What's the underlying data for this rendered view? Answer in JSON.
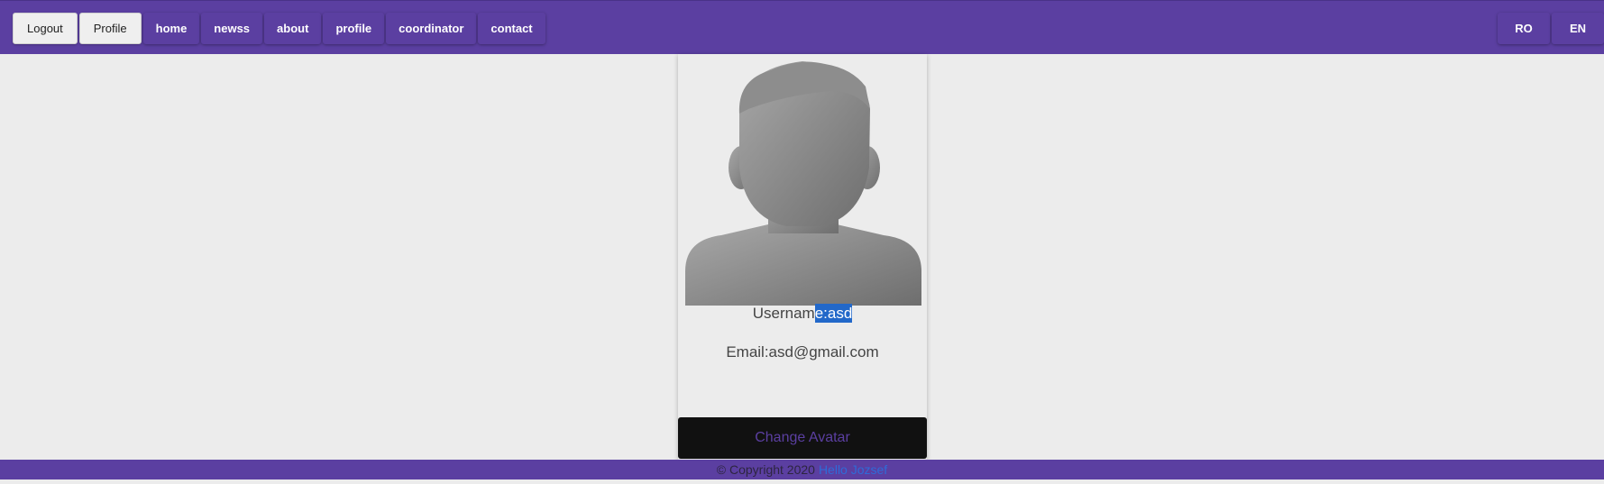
{
  "nav": {
    "logout_label": "Logout",
    "profile_label": "Profile",
    "links": [
      "home",
      "newss",
      "about",
      "profile",
      "coordinator",
      "contact"
    ],
    "lang": [
      "RO",
      "EN"
    ]
  },
  "card": {
    "username_prefix": "Usernam",
    "username_selected": "e:asd",
    "email": "Email:asd@gmail.com",
    "change_avatar_label": "Change Avatar"
  },
  "footer": {
    "copyright": "© Copyright 2020",
    "link_text": "Hello Jozsef"
  },
  "colors": {
    "accent": "#5b3fa1",
    "selection": "#2268c9",
    "link": "#2f6bd8"
  }
}
